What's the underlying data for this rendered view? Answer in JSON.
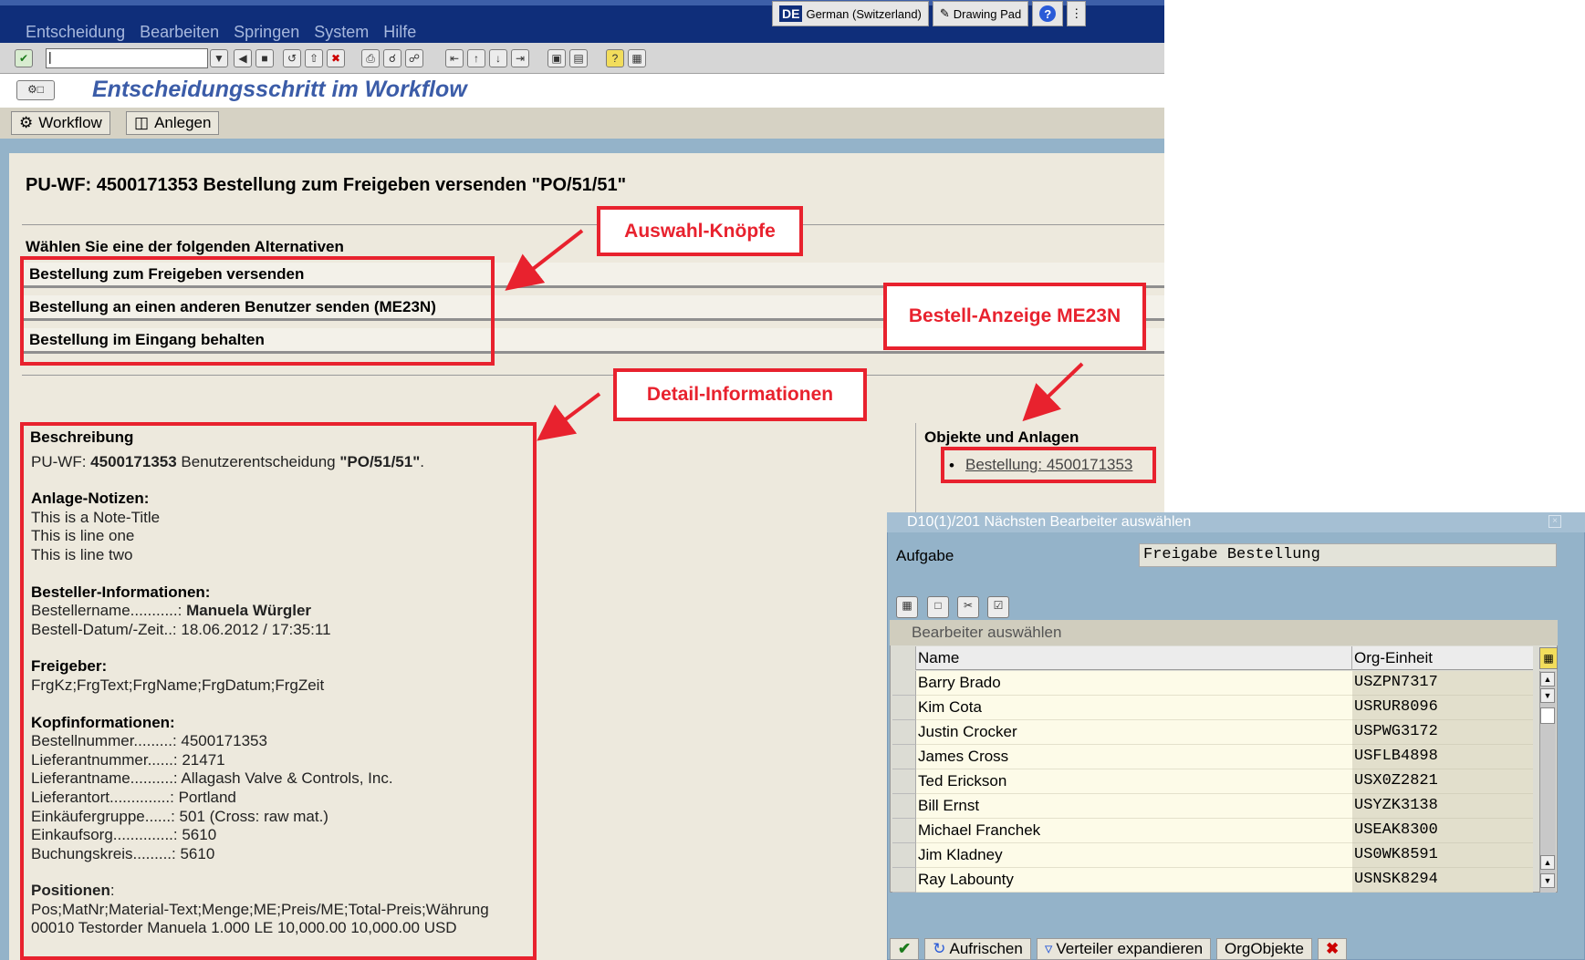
{
  "menu": [
    "Entscheidung",
    "Bearbeiten",
    "Springen",
    "System",
    "Hilfe"
  ],
  "sysbar": {
    "language_code": "DE",
    "language": "German (Switzerland)",
    "drawing_pad": "Drawing Pad",
    "help_glyph": "?"
  },
  "command_field": {
    "value": "|"
  },
  "screen_title": "Entscheidungsschritt im Workflow",
  "app_toolbar": {
    "workflow": "Workflow",
    "anlegen": "Anlegen"
  },
  "workflow_title": "PU-WF: 4500171353 Bestellung zum Freigeben versenden \"PO/51/51\"",
  "alternatives": {
    "heading": "Wählen Sie eine der folgenden Alternativen",
    "items": [
      "Bestellung zum Freigeben versenden",
      "Bestellung an einen anderen Benutzer senden (ME23N)",
      "Bestellung im Eingang behalten"
    ]
  },
  "callouts": {
    "auswahl": "Auswahl-Knöpfe",
    "bestell_anzeige": "Bestell-Anzeige ME23N",
    "detail": "Detail-Informationen"
  },
  "description": {
    "heading": "Beschreibung",
    "line_prefix": "PU-WF: ",
    "line_number": "4500171353",
    "line_mid": " Benutzerentscheidung ",
    "line_po": "\"PO/51/51\"",
    "line_end": ".",
    "notes_heading": "Anlage-Notizen:",
    "notes": [
      "This is a Note-Title",
      "This is line one",
      "This is line two"
    ],
    "orderer_heading": "Besteller-Informationen:",
    "orderer_name_label": "Bestellername...........: ",
    "orderer_name": "Manuela Würgler",
    "orderer_date": "Bestell-Datum/-Zeit..: 18.06.2012 / 17:35:11",
    "approver_heading": "Freigeber:",
    "approver_fields": "FrgKz;FrgText;FrgName;FrgDatum;FrgZeit",
    "header_heading": "Kopfinformationen:",
    "header_lines": [
      "Bestellnummer.........: 4500171353",
      "Lieferantnummer......: 21471",
      "Lieferantname..........: Allagash Valve & Controls, Inc.",
      "Lieferantort..............: Portland",
      "Einkäufergruppe......: 501 (Cross: raw mat.)",
      "Einkaufsorg..............: 5610",
      "Buchungskreis.........: 5610"
    ],
    "positions_heading": "Positionen",
    "positions_colon": ":",
    "positions_lines": [
      "Pos;MatNr;Material-Text;Menge;ME;Preis/ME;Total-Preis;Währung",
      "00010 Testorder Manuela 1.000 LE 10,000.00 10,000.00 USD"
    ]
  },
  "objects": {
    "heading": "Objekte und Anlagen",
    "link": "Bestellung: 4500171353"
  },
  "dialog": {
    "title": "D10(1)/201 Nächsten Bearbeiter auswählen",
    "aufgabe_label": "Aufgabe",
    "aufgabe_value": "Freigabe Bestellung",
    "grid_title": "Bearbeiter auswählen",
    "columns": [
      "Name",
      "Org-Einheit"
    ],
    "rows": [
      {
        "name": "Barry Brado",
        "org": "USZPN7317"
      },
      {
        "name": "Kim Cota",
        "org": "USRUR8096"
      },
      {
        "name": "Justin Crocker",
        "org": "USPWG3172"
      },
      {
        "name": "James Cross",
        "org": "USFLB4898"
      },
      {
        "name": "Ted Erickson",
        "org": "USX0Z2821"
      },
      {
        "name": "Bill Ernst",
        "org": "USYZK3138"
      },
      {
        "name": "Michael Franchek",
        "org": "USEAK8300"
      },
      {
        "name": "Jim Kladney",
        "org": "US0WK8591"
      },
      {
        "name": "Ray Labounty",
        "org": "USNSK8294"
      }
    ],
    "buttons": {
      "refresh": "Aufrischen",
      "expand": "Verteiler expandieren",
      "orgobjects": "OrgObjekte"
    }
  },
  "colors": {
    "sap_blue": "#0f2e7a",
    "annotation_red": "#e8222e",
    "title_blue": "#3b5ca8"
  }
}
